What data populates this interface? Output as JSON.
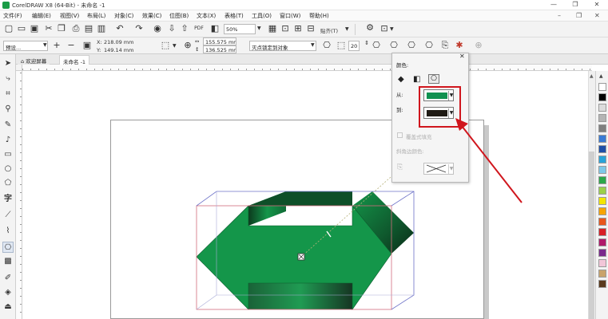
{
  "window": {
    "title": "CorelDRAW X8 (64-Bit) - 未命名 -1",
    "minimize_label": "—",
    "restore_label": "❐",
    "close_label": "✕"
  },
  "menu": {
    "items": [
      "文件(F)",
      "编辑(E)",
      "视图(V)",
      "布局(L)",
      "对象(C)",
      "效果(C)",
      "位图(B)",
      "文本(X)",
      "表格(T)",
      "工具(O)",
      "窗口(W)",
      "帮助(H)"
    ]
  },
  "toolbar": {
    "zoom_value": "50%",
    "snap_label": "贴齐(T)",
    "preset_value": "预设..."
  },
  "property_bar": {
    "x_label": "X:",
    "x_value": "218.09 mm",
    "y_label": "Y:",
    "y_value": "149.14 mm",
    "vp_x_value": "155.575 mm",
    "vp_y_value": "136.525 mm",
    "vanish_lock_value": "灭点锁定到对象",
    "depth_value": "20"
  },
  "tabs": {
    "welcome": "欢迎屏幕",
    "document": "未命名 -1"
  },
  "docker": {
    "color_heading": "颜色:",
    "from_label": "从:",
    "to_label": "到:",
    "from_color": "#119150",
    "to_color": "#1f1a14",
    "overprint_label": "覆盖式填充",
    "bevel_color_label": "斜角边颜色:",
    "close_label": "✕"
  },
  "palette": {
    "colors": [
      "#ffffff",
      "#000000",
      "#dcdcdc",
      "#b4b4b4",
      "#7f7f7f",
      "#3a7bd5",
      "#1e4fa8",
      "#29a3d9",
      "#7ec8e8",
      "#2ca84a",
      "#9bd04a",
      "#f3e600",
      "#f7a400",
      "#e8561c",
      "#d81f26",
      "#b0196a",
      "#7a2a8c",
      "#f2c6d8",
      "#c9a36b",
      "#5a3a1e"
    ]
  },
  "colors": {
    "extrude_face": "#14964a",
    "extrude_dark": "#0c3a1e",
    "highlight_red": "#d0161d"
  },
  "icons": {
    "app": "coreldraw-logo-icon",
    "new": "new-document-icon",
    "open": "open-folder-icon",
    "save": "save-icon",
    "print": "print-icon",
    "undo": "undo-icon",
    "redo": "redo-icon",
    "options": "gear-icon"
  }
}
